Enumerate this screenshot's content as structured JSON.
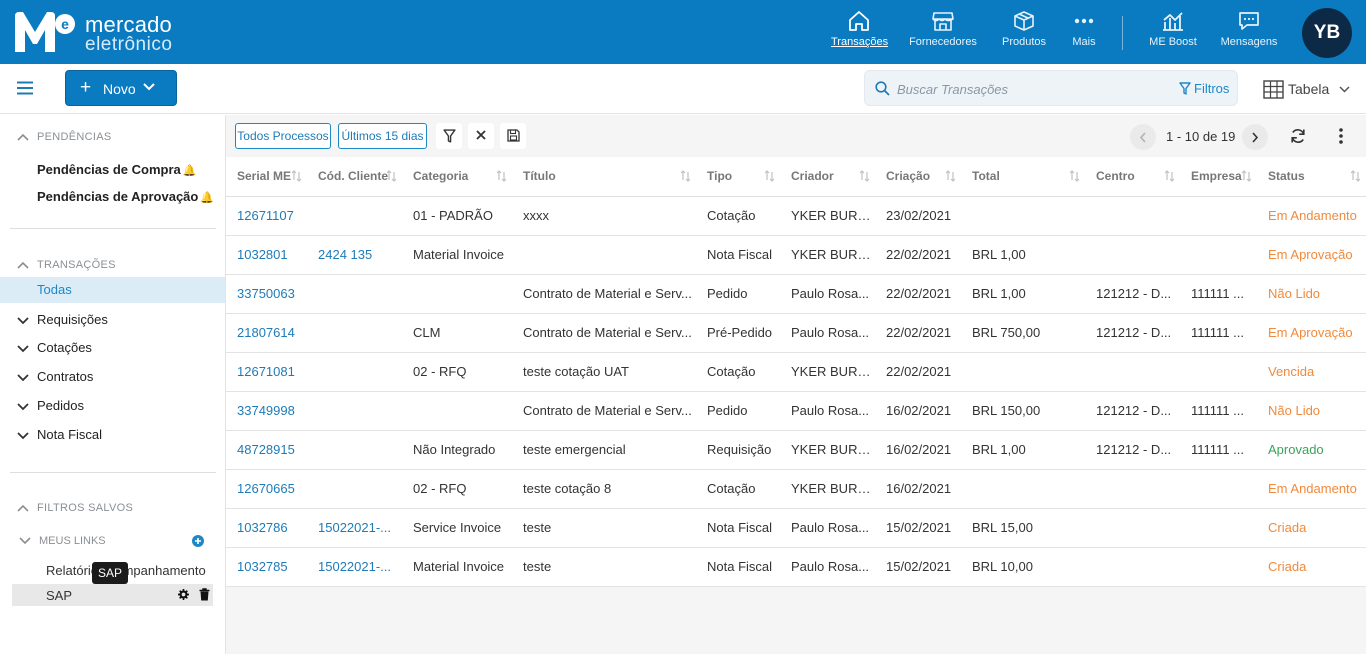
{
  "brand": {
    "line1": "mercado",
    "line2": "eletrônico",
    "logo_letters": "Me"
  },
  "nav": [
    {
      "label": "Transações",
      "icon": "home-icon",
      "active": true
    },
    {
      "label": "Fornecedores",
      "icon": "store-icon",
      "active": false
    },
    {
      "label": "Produtos",
      "icon": "cube-icon",
      "active": false
    },
    {
      "label": "Mais",
      "icon": "more-dots-icon",
      "active": false
    },
    {
      "label": "ME Boost",
      "icon": "bar-chart-icon",
      "active": false
    },
    {
      "label": "Mensagens",
      "icon": "message-icon",
      "active": false
    }
  ],
  "avatar": {
    "initials": "YB"
  },
  "subbar": {
    "novo_label": "Novo",
    "search_placeholder": "Buscar Transações",
    "filtros_label": "Filtros",
    "view_label": "Tabela"
  },
  "sidebar": {
    "pendencias_title": "PENDÊNCIAS",
    "pendencias": [
      "Pendências de Compra",
      "Pendências de Aprovação"
    ],
    "transacoes_title": "TRANSAÇÕES",
    "todas": "Todas",
    "transacoes": [
      "Requisições",
      "Cotações",
      "Contratos",
      "Pedidos",
      "Nota Fiscal"
    ],
    "filtros_title": "FILTROS SALVOS",
    "meus_links_title": "MEUS LINKS",
    "links": [
      "Relatório acompanhamento",
      "SAP"
    ],
    "tooltip": "SAP"
  },
  "toolbar": {
    "todos_processos": "Todos Processos",
    "ultimos_15": "Últimos 15 dias",
    "pager_text": "1 - 10 de 19"
  },
  "colors": {
    "primary": "#0a7bc1",
    "status_orange": "#f08a3c",
    "status_green": "#3aa35a",
    "link": "#1e7bb8"
  },
  "table": {
    "columns": [
      "Serial ME",
      "Cód. Cliente",
      "Categoria",
      "Título",
      "Tipo",
      "Criador",
      "Criação",
      "Total",
      "Centro",
      "Empresa",
      "Status"
    ],
    "rows": [
      [
        "12671107",
        "",
        "01 - PADRÃO",
        "xxxx",
        "Cotação",
        "YKER BURU...",
        "23/02/2021",
        "",
        "",
        "",
        "Em Andamento"
      ],
      [
        "1032801",
        "2424 135",
        "Material Invoice",
        "",
        "Nota Fiscal",
        "YKER BURU...",
        "22/02/2021",
        "BRL 1,00",
        "",
        "",
        "Em Aprovação"
      ],
      [
        "33750063",
        "",
        "",
        "Contrato de Material e Serv...",
        "Pedido",
        "Paulo Rosa...",
        "22/02/2021",
        "BRL 1,00",
        "121212 - D...",
        "111111 ...",
        "Não Lido"
      ],
      [
        "21807614",
        "",
        "CLM",
        "Contrato de Material e Serv...",
        "Pré-Pedido",
        "Paulo Rosa...",
        "22/02/2021",
        "BRL 750,00",
        "121212 - D...",
        "111111 ...",
        "Em Aprovação"
      ],
      [
        "12671081",
        "",
        "02 - RFQ",
        "teste cotação UAT",
        "Cotação",
        "YKER BURU...",
        "22/02/2021",
        "",
        "",
        "",
        "Vencida"
      ],
      [
        "33749998",
        "",
        "",
        "Contrato de Material e Serv...",
        "Pedido",
        "Paulo Rosa...",
        "16/02/2021",
        "BRL 150,00",
        "121212 - D...",
        "111111 ...",
        "Não Lido"
      ],
      [
        "48728915",
        "",
        "Não Integrado",
        "teste emergencial",
        "Requisição",
        "YKER BURU...",
        "16/02/2021",
        "BRL 1,00",
        "121212 - D...",
        "111111 ...",
        "Aprovado"
      ],
      [
        "12670665",
        "",
        "02 - RFQ",
        "teste cotação 8",
        "Cotação",
        "YKER BURU...",
        "16/02/2021",
        "",
        "",
        "",
        "Em Andamento"
      ],
      [
        "1032786",
        "15022021-...",
        "Service Invoice",
        "teste",
        "Nota Fiscal",
        "Paulo Rosa...",
        "15/02/2021",
        "BRL 15,00",
        "",
        "",
        "Criada"
      ],
      [
        "1032785",
        "15022021-...",
        "Material Invoice",
        "teste",
        "Nota Fiscal",
        "Paulo Rosa...",
        "15/02/2021",
        "BRL 10,00",
        "",
        "",
        "Criada"
      ]
    ]
  }
}
